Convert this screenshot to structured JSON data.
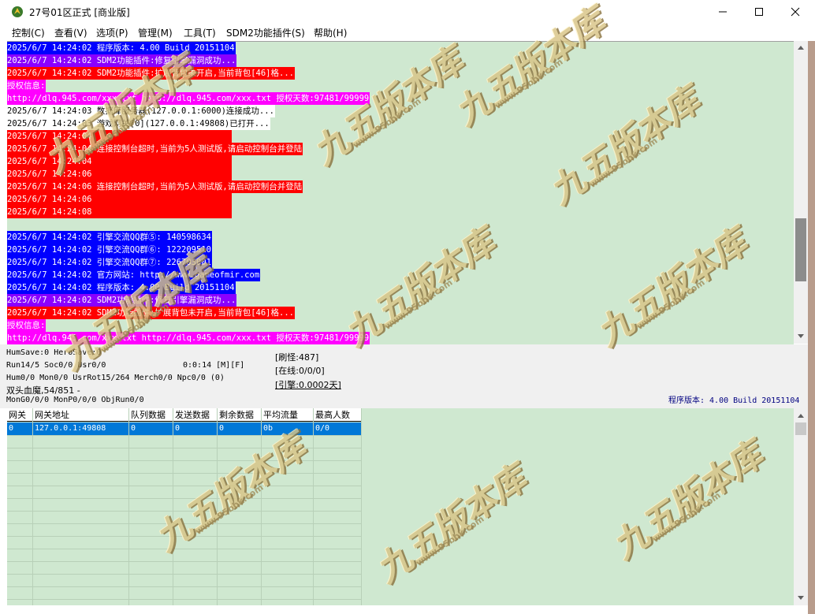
{
  "window": {
    "title": "27号01区正式 [商业版]",
    "icon": "app-dragon-icon",
    "controls": {
      "minimize": "minimize-icon",
      "maximize": "maximize-icon",
      "close": "close-icon"
    }
  },
  "menu": {
    "items": [
      "控制(C)",
      "查看(V)",
      "选项(P)",
      "管理(M)",
      "工具(T)",
      "SDM2功能插件(S)",
      "帮助(H)"
    ]
  },
  "log": {
    "lines": [
      {
        "text": "2025/6/7 14:24:02 程序版本: 4.00 Build 20151104",
        "color": "blue"
      },
      {
        "text": "2025/6/7 14:24:02 SDM2功能插件:修复引擎漏洞成功...",
        "color": "purple"
      },
      {
        "text": "2025/6/7 14:24:02 SDM2功能插件:扩展背包未开启,当前背包[46]格...",
        "color": "red"
      },
      {
        "text": "授权信息:",
        "color": "magenta"
      },
      {
        "text": "http://dlq.945.com/xxx.txt http://dlq.945.com/xxx.txt 授权天数:97481/99999",
        "color": "magenta"
      },
      {
        "text": "2025/6/7 14:24:03 数据库服务器(127.0.0.1:6000)连接成功...",
        "color": "white"
      },
      {
        "text": "2025/6/7 14:24:03 游戏网关[0](127.0.0.1:49808)已打开...",
        "color": "white"
      },
      {
        "text": "2025/6/7 14:24:04 ",
        "color": "red"
      },
      {
        "text": "2025/6/7 14:24:04 连接控制台超时,当前为5人测试版,请启动控制台并登陆",
        "color": "red"
      },
      {
        "text": "2025/6/7 14:24:04 ",
        "color": "red"
      },
      {
        "text": "2025/6/7 14:24:06 ",
        "color": "red"
      },
      {
        "text": "2025/6/7 14:24:06 连接控制台超时,当前为5人测试版,请启动控制台并登陆",
        "color": "red"
      },
      {
        "text": "2025/6/7 14:24:06 ",
        "color": "red"
      },
      {
        "text": "2025/6/7 14:24:08 ",
        "color": "red"
      },
      {
        "text": "",
        "color": "none"
      },
      {
        "text": "2025/6/7 14:24:02 引擎交流QQ群⑤: 140598634",
        "color": "blue"
      },
      {
        "text": "2025/6/7 14:24:02 引擎交流QQ群⑥: 122209510",
        "color": "blue"
      },
      {
        "text": "2025/6/7 14:24:02 引擎交流QQ群⑦: 226703001",
        "color": "blue"
      },
      {
        "text": "2025/6/7 14:24:02 官方网站: http://www.gameofmir.com",
        "color": "blue"
      },
      {
        "text": "2025/6/7 14:24:02 程序版本: 4.00 Build 20151104",
        "color": "blue"
      },
      {
        "text": "2025/6/7 14:24:02 SDM2功能插件:修复引擎漏洞成功...",
        "color": "purple"
      },
      {
        "text": "2025/6/7 14:24:02 SDM2功能插件:扩展背包未开启,当前背包[46]格...",
        "color": "red"
      },
      {
        "text": "授权信息:",
        "color": "magenta"
      },
      {
        "text": "http://dlq.945.com/xxx.txt http://dlq.945.com/xxx.txt 授权天数:97481/99999",
        "color": "magenta"
      }
    ]
  },
  "stats": {
    "hum_save": "HumSave:0 HeroSave:0",
    "run": "Run14/5 Soc0/0 Usr0/0",
    "timer": "0:0:14 [M][F]",
    "hum_mon": "Hum0/0 Mon0/0 UsrRot15/264 Merch0/0 Npc0/0 (0)",
    "monster": "双头血魔,54/851 -",
    "mon_gen": "MonG0/0/0 MonP0/0/0 ObjRun0/0",
    "refresh": "[刷怪:487]",
    "online": "[在线:0/0/0]",
    "engine": "[引擎:0.0002天]",
    "version": "程序版本: 4.00 Build 20151104"
  },
  "gateway_table": {
    "columns": [
      "网关",
      "网关地址",
      "队列数据",
      "发送数据",
      "剩余数据",
      "平均流量",
      "最高人数"
    ],
    "rows": [
      [
        "0",
        "127.0.0.1:49808",
        "0",
        "0",
        "0",
        "0b",
        "0/0"
      ]
    ]
  },
  "watermark": {
    "text": "九五版本库",
    "url": "www.95bbk.com"
  },
  "colors": {
    "log_bg": "#cfe8d0",
    "blue": "#0000ff",
    "purple": "#8a00ff",
    "red": "#ff0000",
    "magenta": "#ff00ff",
    "selection": "#0078d7",
    "version_text": "#000080"
  }
}
